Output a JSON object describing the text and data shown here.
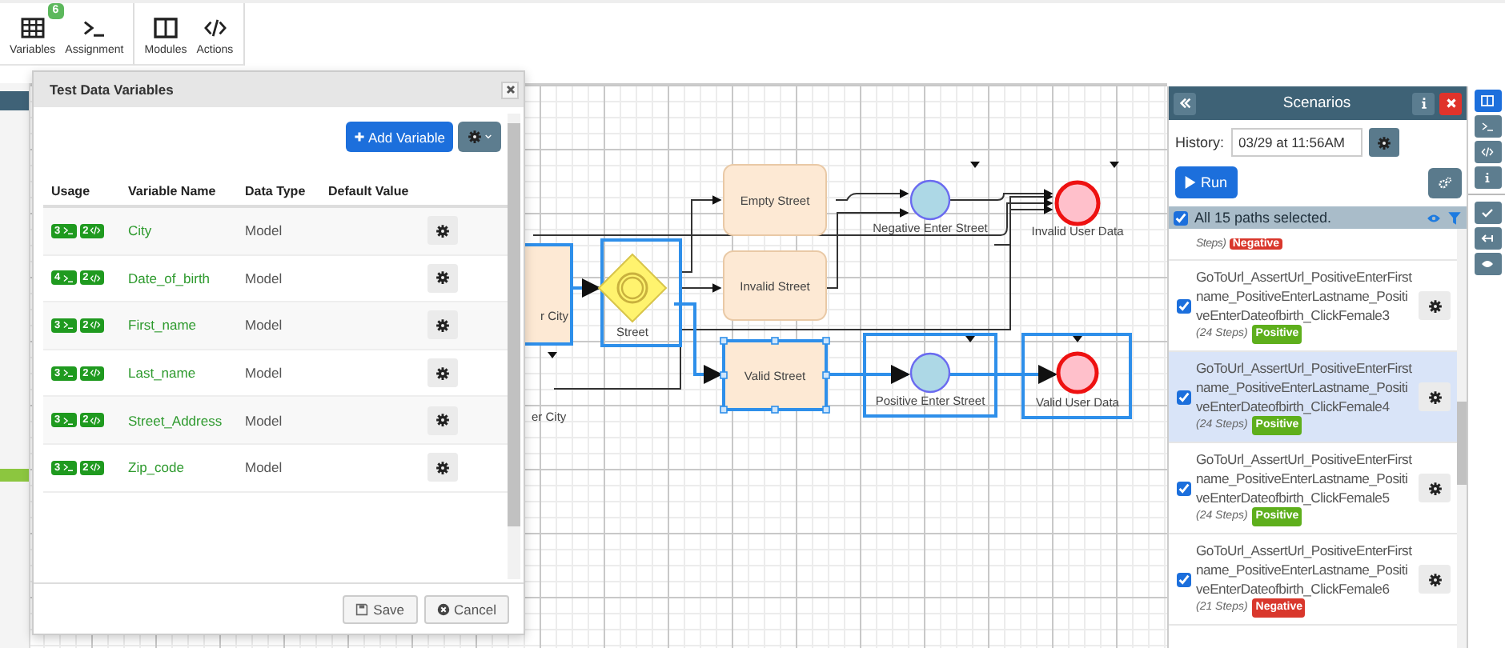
{
  "toolbar": {
    "groups": [
      {
        "items": [
          {
            "kind": "table",
            "label": "Variables",
            "badge": "6"
          },
          {
            "kind": "terminal",
            "label": "Assignment"
          }
        ]
      },
      {
        "items": [
          {
            "kind": "columns",
            "label": "Modules"
          },
          {
            "kind": "code",
            "label": "Actions"
          }
        ]
      }
    ]
  },
  "dialog": {
    "title": "Test Data Variables",
    "add_button": "Add Variable",
    "columns": [
      "Usage",
      "Variable Name",
      "Data Type",
      "Default Value"
    ],
    "rows": [
      {
        "assignments": "3",
        "actions": "2",
        "name": "City",
        "data_type": "Model"
      },
      {
        "assignments": "4",
        "actions": "2",
        "name": "Date_of_birth",
        "data_type": "Model"
      },
      {
        "assignments": "3",
        "actions": "2",
        "name": "First_name",
        "data_type": "Model"
      },
      {
        "assignments": "3",
        "actions": "2",
        "name": "Last_name",
        "data_type": "Model"
      },
      {
        "assignments": "3",
        "actions": "2",
        "name": "Street_Address",
        "data_type": "Model"
      },
      {
        "assignments": "3",
        "actions": "2",
        "name": "Zip_code",
        "data_type": "Model"
      }
    ],
    "buttons": [
      {
        "kind": "save",
        "label": "Save"
      },
      {
        "kind": "cancel",
        "label": "Cancel"
      }
    ]
  },
  "diagram": {
    "nodes": [
      {
        "kind": "task",
        "label": "r City",
        "selected": true
      },
      {
        "kind": "label",
        "label": "er City",
        "selected": false
      },
      {
        "kind": "gateway",
        "label": "Street",
        "selected": true
      },
      {
        "kind": "task",
        "label": "Empty Street",
        "selected": false
      },
      {
        "kind": "task",
        "label": "Invalid Street",
        "selected": false
      },
      {
        "kind": "task",
        "label": "Valid Street",
        "selected": true
      },
      {
        "kind": "event",
        "label": "Negative Enter Street",
        "selected": false
      },
      {
        "kind": "end",
        "label": "Invalid User Data",
        "selected": false
      },
      {
        "kind": "event",
        "label": "Positive Enter Street",
        "selected": true
      },
      {
        "kind": "end",
        "label": "Valid User Data",
        "selected": true
      }
    ]
  },
  "scenarios": {
    "title": "Scenarios",
    "history_label": "History:",
    "history_value": "03/29 at 11:56AM",
    "run_button": "Run",
    "select_all": {
      "label": "All 15 paths selected.",
      "checked": true
    },
    "paths": [
      {
        "kind": "partial",
        "steps": "Steps)",
        "tag": "Negative",
        "color": "#d9372c",
        "selected": false
      },
      {
        "kind": "path",
        "name": "GoToUrl_AssertUrl_PositiveEnterFirstname_PositiveEnterLastname_PositiveEnterDateofbirth_ClickFemale3",
        "steps": "(24 Steps)",
        "tag": "Positive",
        "color": "#5eaf1c",
        "checked": true,
        "selected": false
      },
      {
        "kind": "path",
        "name": "GoToUrl_AssertUrl_PositiveEnterFirstname_PositiveEnterLastname_PositiveEnterDateofbirth_ClickFemale4",
        "steps": "(24 Steps)",
        "tag": "Positive",
        "color": "#5eaf1c",
        "checked": true,
        "selected": true
      },
      {
        "kind": "path",
        "name": "GoToUrl_AssertUrl_PositiveEnterFirstname_PositiveEnterLastname_PositiveEnterDateofbirth_ClickFemale5",
        "steps": "(24 Steps)",
        "tag": "Positive",
        "color": "#5eaf1c",
        "checked": true,
        "selected": false
      },
      {
        "kind": "path",
        "name": "GoToUrl_AssertUrl_PositiveEnterFirstname_PositiveEnterLastname_PositiveEnterDateofbirth_ClickFemale6",
        "steps": "(21 Steps)",
        "tag": "Negative",
        "color": "#d9372c",
        "checked": true,
        "selected": false
      }
    ]
  },
  "side_tools": {
    "groups": [
      {
        "tools": [
          {
            "kind": "columns",
            "selected": true
          },
          {
            "kind": "terminal",
            "selected": false
          },
          {
            "kind": "code",
            "selected": false
          },
          {
            "kind": "info",
            "selected": false
          }
        ]
      },
      {
        "tools": [
          {
            "kind": "check",
            "selected": false
          },
          {
            "kind": "arrow",
            "selected": false
          },
          {
            "kind": "eye",
            "selected": false
          }
        ]
      }
    ]
  }
}
